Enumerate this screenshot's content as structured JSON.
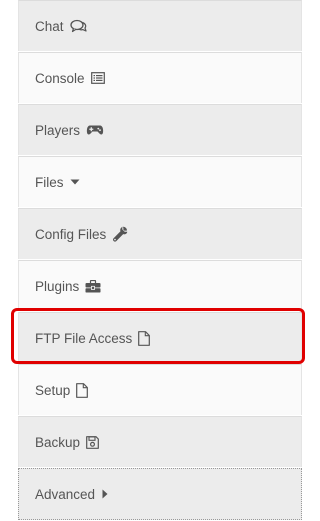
{
  "menu": {
    "items": [
      {
        "label": "Chat",
        "icon": "chat-bubbles-icon"
      },
      {
        "label": "Console",
        "icon": "console-list-icon"
      },
      {
        "label": "Players",
        "icon": "gamepad-icon"
      },
      {
        "label": "Files",
        "icon": "caret-down-icon"
      },
      {
        "label": "Config Files",
        "icon": "wrench-icon"
      },
      {
        "label": "Plugins",
        "icon": "puzzle-toolbox-icon"
      },
      {
        "label": "FTP File Access",
        "icon": "file-icon"
      },
      {
        "label": "Setup",
        "icon": "file-icon"
      },
      {
        "label": "Backup",
        "icon": "floppy-icon"
      },
      {
        "label": "Advanced",
        "icon": "caret-right-icon"
      }
    ]
  },
  "highlight": {
    "target": "FTP File Access",
    "color": "#e00000"
  }
}
